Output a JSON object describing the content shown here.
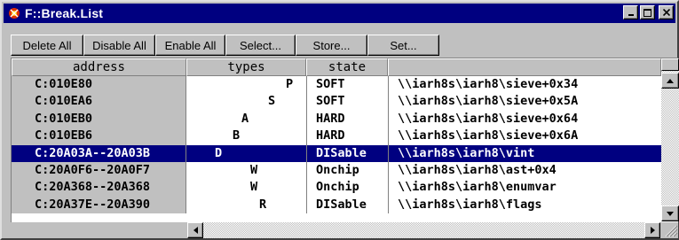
{
  "window": {
    "title": "F::Break.List",
    "minimize_icon": "minimize-icon",
    "maximize_icon": "maximize-icon",
    "close_icon": "close-icon"
  },
  "toolbar": {
    "buttons": [
      "Delete All",
      "Disable All",
      "Enable All",
      "Select...",
      "Store...",
      "Set..."
    ]
  },
  "table": {
    "columns": [
      "address",
      "types",
      "state",
      ""
    ],
    "selected_index": 4,
    "rows": [
      {
        "address": "C:010E80",
        "type": "P",
        "state": "SOFT",
        "symbol": "\\\\iarh8s\\iarh8\\sieve+0x34"
      },
      {
        "address": "C:010EA6",
        "type": "S",
        "state": "SOFT",
        "symbol": "\\\\iarh8s\\iarh8\\sieve+0x5A"
      },
      {
        "address": "C:010EB0",
        "type": "A",
        "state": "HARD",
        "symbol": "\\\\iarh8s\\iarh8\\sieve+0x64"
      },
      {
        "address": "C:010EB6",
        "type": "B",
        "state": "HARD",
        "symbol": "\\\\iarh8s\\iarh8\\sieve+0x6A"
      },
      {
        "address": "C:20A03A--20A03B",
        "type": "D",
        "state": "DISable",
        "symbol": "\\\\iarh8s\\iarh8\\vint"
      },
      {
        "address": "C:20A0F6--20A0F7",
        "type": "W",
        "state": "Onchip",
        "symbol": "\\\\iarh8s\\iarh8\\ast+0x4"
      },
      {
        "address": "C:20A368--20A368",
        "type": "W",
        "state": "Onchip",
        "symbol": "\\\\iarh8s\\iarh8\\enumvar"
      },
      {
        "address": "C:20A37E--20A390",
        "type": "R",
        "state": "DISable",
        "symbol": "\\\\iarh8s\\iarh8\\flags"
      }
    ]
  },
  "colors": {
    "title_bar": "#000080",
    "selection": "#000080",
    "face": "#c0c0c0"
  }
}
